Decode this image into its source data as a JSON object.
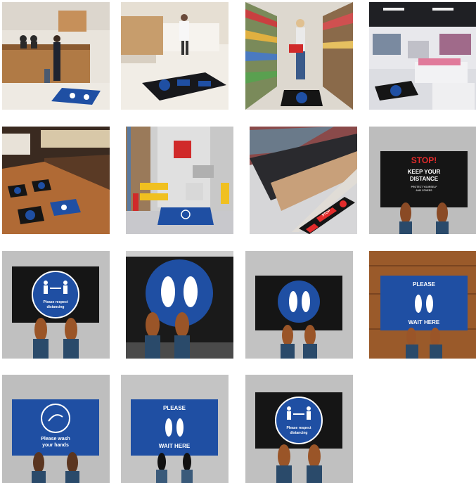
{
  "mat_texts": {
    "stop_title": "STOP!",
    "stop_line1": "KEEP YOUR",
    "stop_line2": "DISTANCE",
    "stop_small1": "PROTECT YOURSELF",
    "stop_small2": "AND OTHERS",
    "respect_line1": "Please respect",
    "respect_line2": "distancing",
    "please": "PLEASE",
    "wait_here": "WAIT HERE",
    "wash_line1": "Please wash",
    "wash_line2": "your hands",
    "stop_strip": "STOP"
  },
  "colors": {
    "mat_blue": "#1f4fa3",
    "mat_black": "#151515",
    "stop_red": "#e32b2b",
    "wood": "#9a5a2a",
    "floor_grey": "#bdbdbd"
  }
}
